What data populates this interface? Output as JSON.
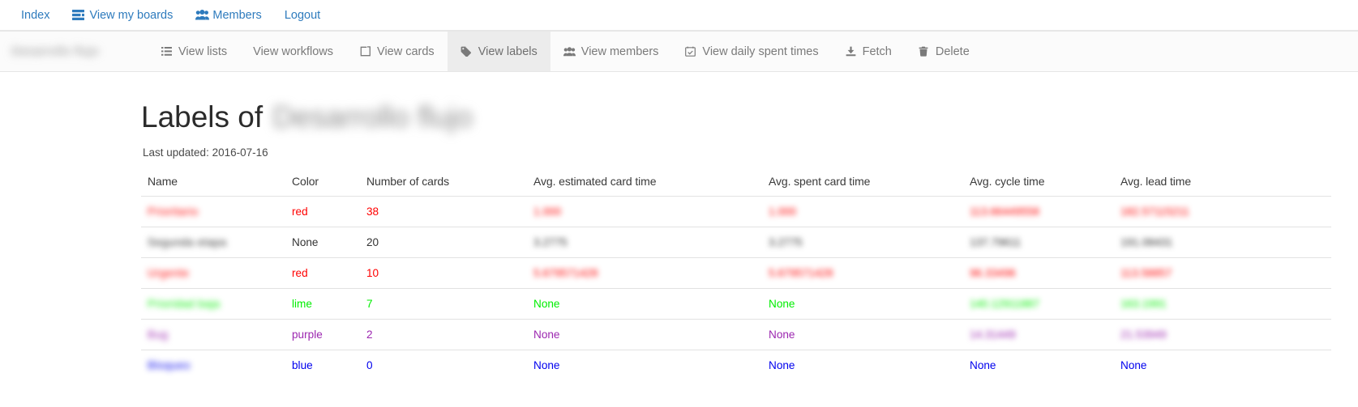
{
  "navbar": {
    "items": [
      {
        "label": "Index",
        "icon": "none"
      },
      {
        "label": "View my boards",
        "icon": "boards-icon"
      },
      {
        "label": "Members",
        "icon": "members-icon"
      },
      {
        "label": "Logout",
        "icon": "none"
      }
    ]
  },
  "tabbar": {
    "board_name": "Desarrollo flujo",
    "tabs": [
      {
        "label": "View lists",
        "icon": "list-icon",
        "active": false
      },
      {
        "label": "View workflows",
        "icon": "none",
        "active": false
      },
      {
        "label": "View cards",
        "icon": "card-icon",
        "active": false
      },
      {
        "label": "View labels",
        "icon": "tag-icon",
        "active": true
      },
      {
        "label": "View members",
        "icon": "members-icon",
        "active": false
      },
      {
        "label": "View daily spent times",
        "icon": "calendar-check-icon",
        "active": false
      },
      {
        "label": "Fetch",
        "icon": "download-icon",
        "active": false
      },
      {
        "label": "Delete",
        "icon": "trash-icon",
        "active": false
      }
    ]
  },
  "page": {
    "title_prefix": "Labels of",
    "title_board": "Desarrollo flujo",
    "last_updated_label": "Last updated: 2016-07-16"
  },
  "table": {
    "headers": [
      "Name",
      "Color",
      "Number of cards",
      "Avg. estimated card time",
      "Avg. spent card time",
      "Avg. cycle time",
      "Avg. lead time"
    ],
    "rows": [
      {
        "name": "Prioritario",
        "name_redacted": true,
        "color": "red",
        "color_hex": "#ff0000",
        "number_of_cards": "38",
        "avg_estimated_card_time": "1.000",
        "est_redacted": true,
        "avg_spent_card_time": "1.000",
        "spent_redacted": true,
        "avg_cycle_time": "113.66449558",
        "cycle_redacted": true,
        "avg_lead_time": "182.57115211",
        "lead_redacted": true
      },
      {
        "name": "Segunda etapa",
        "name_redacted": true,
        "color": "None",
        "color_hex": "#333333",
        "number_of_cards": "20",
        "avg_estimated_card_time": "3.2775",
        "est_redacted": true,
        "avg_spent_card_time": "3.2775",
        "spent_redacted": true,
        "avg_cycle_time": "137.79611",
        "cycle_redacted": true,
        "avg_lead_time": "191.08431",
        "lead_redacted": true
      },
      {
        "name": "Urgente",
        "name_redacted": true,
        "color": "red",
        "color_hex": "#ff0000",
        "number_of_cards": "10",
        "avg_estimated_card_time": "5.679571428",
        "est_redacted": true,
        "avg_spent_card_time": "5.679571428",
        "spent_redacted": true,
        "avg_cycle_time": "96.33496",
        "cycle_redacted": true,
        "avg_lead_time": "113.58857",
        "lead_redacted": true
      },
      {
        "name": "Prioridad baja",
        "name_redacted": true,
        "color": "lime",
        "color_hex": "#00ee00",
        "number_of_cards": "7",
        "avg_estimated_card_time": "None",
        "est_redacted": false,
        "avg_spent_card_time": "None",
        "spent_redacted": false,
        "avg_cycle_time": "140.12911887",
        "cycle_redacted": true,
        "avg_lead_time": "163.1991",
        "lead_redacted": true
      },
      {
        "name": "Bug",
        "name_redacted": true,
        "color": "purple",
        "color_hex": "#9c27b0",
        "number_of_cards": "2",
        "avg_estimated_card_time": "None",
        "est_redacted": false,
        "avg_spent_card_time": "None",
        "spent_redacted": false,
        "avg_cycle_time": "14.31449",
        "cycle_redacted": true,
        "avg_lead_time": "21.53949",
        "lead_redacted": true
      },
      {
        "name": "Bloqueo",
        "name_redacted": true,
        "color": "blue",
        "color_hex": "#0000ee",
        "number_of_cards": "0",
        "avg_estimated_card_time": "None",
        "est_redacted": false,
        "avg_spent_card_time": "None",
        "spent_redacted": false,
        "avg_cycle_time": "None",
        "cycle_redacted": false,
        "avg_lead_time": "None",
        "lead_redacted": false
      }
    ]
  }
}
